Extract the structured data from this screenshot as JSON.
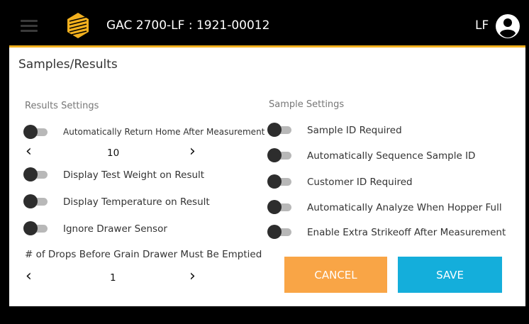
{
  "header": {
    "title": "GAC 2700-LF : 1921-00012",
    "user_initials": "LF",
    "icons": {
      "menu": "hamburger-menu-icon",
      "logo": "gac-logo-icon",
      "user": "account-circle-icon"
    }
  },
  "page": {
    "title": "Samples/Results"
  },
  "results_settings": {
    "heading": "Results Settings",
    "auto_return_home": "Automatically Return Home After Measurement",
    "auto_return_value": "10",
    "display_test_weight": "Display Test Weight on Result",
    "display_temperature": "Display Temperature on Result",
    "ignore_drawer_sensor": "Ignore Drawer Sensor",
    "drops_label": "# of Drops Before Grain Drawer Must Be Emptied",
    "drops_value": "1"
  },
  "sample_settings": {
    "heading": "Sample Settings",
    "sample_id_required": "Sample ID Required",
    "auto_sequence_sample_id": "Automatically Sequence Sample ID",
    "customer_id_required": "Customer ID Required",
    "auto_analyze_hopper_full": "Automatically Analyze When Hopper Full",
    "extra_strikeoff": "Enable Extra Strikeoff After Measurement"
  },
  "stepper": {
    "prev": "‹",
    "next": "›"
  },
  "buttons": {
    "cancel": "CANCEL",
    "save": "SAVE"
  },
  "colors": {
    "accent_gold": "#f2b01e",
    "cancel": "#f9a546",
    "save": "#14aedb"
  }
}
